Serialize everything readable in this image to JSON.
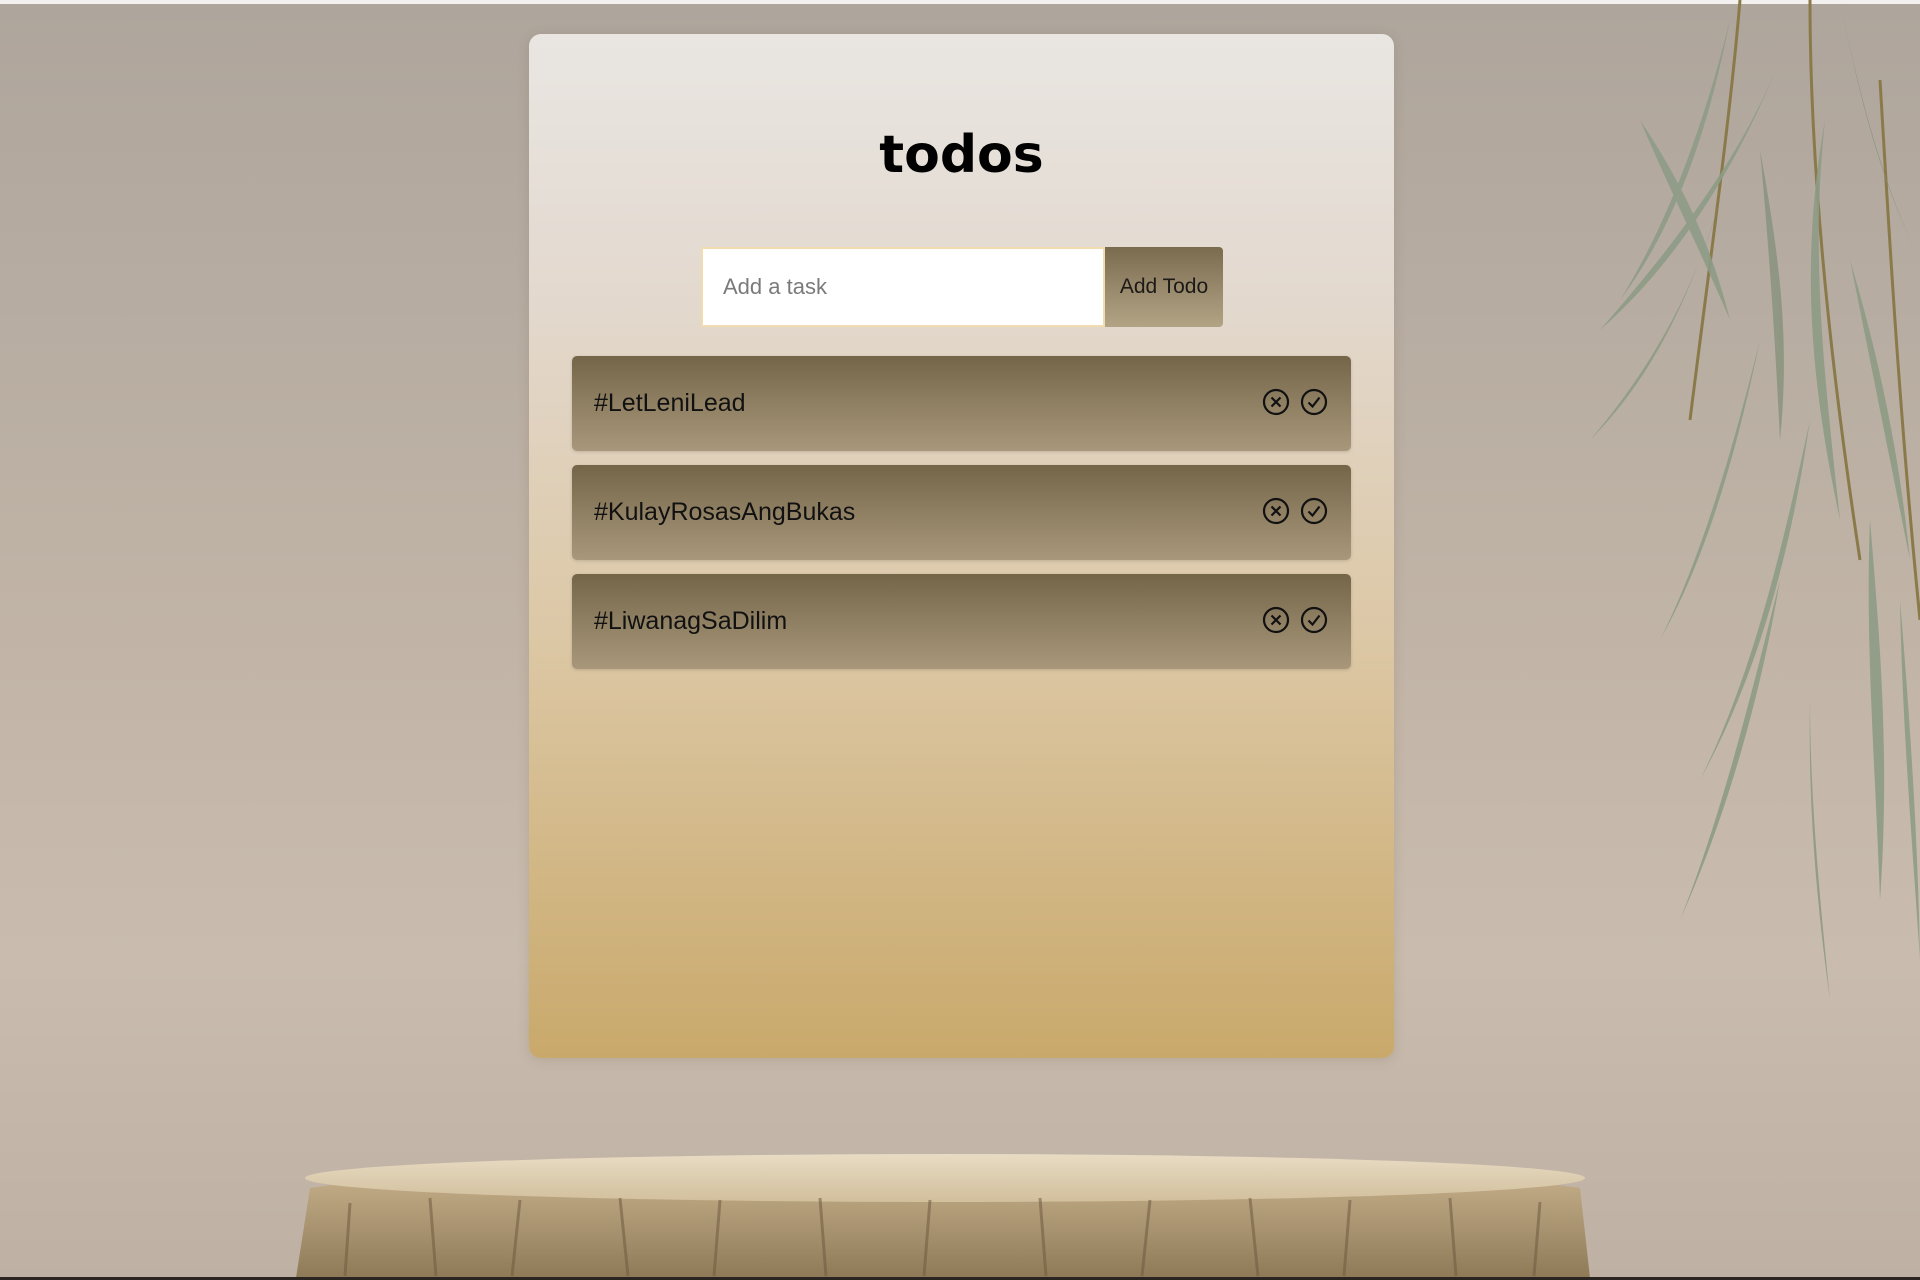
{
  "app": {
    "title": "todos"
  },
  "add_form": {
    "placeholder": "Add a task",
    "input_value": "",
    "button_label": "Add Todo"
  },
  "todos": [
    {
      "text": "#LetLeniLead"
    },
    {
      "text": "#KulayRosasAngBukas"
    },
    {
      "text": "#LiwanagSaDilim"
    }
  ],
  "icons": {
    "remove": "circle-x-icon",
    "complete": "circle-check-icon"
  },
  "colors": {
    "item_gradient_top": "#756548",
    "item_gradient_bottom": "#a8977a",
    "card_gradient_bottom": "#c9a96b"
  }
}
